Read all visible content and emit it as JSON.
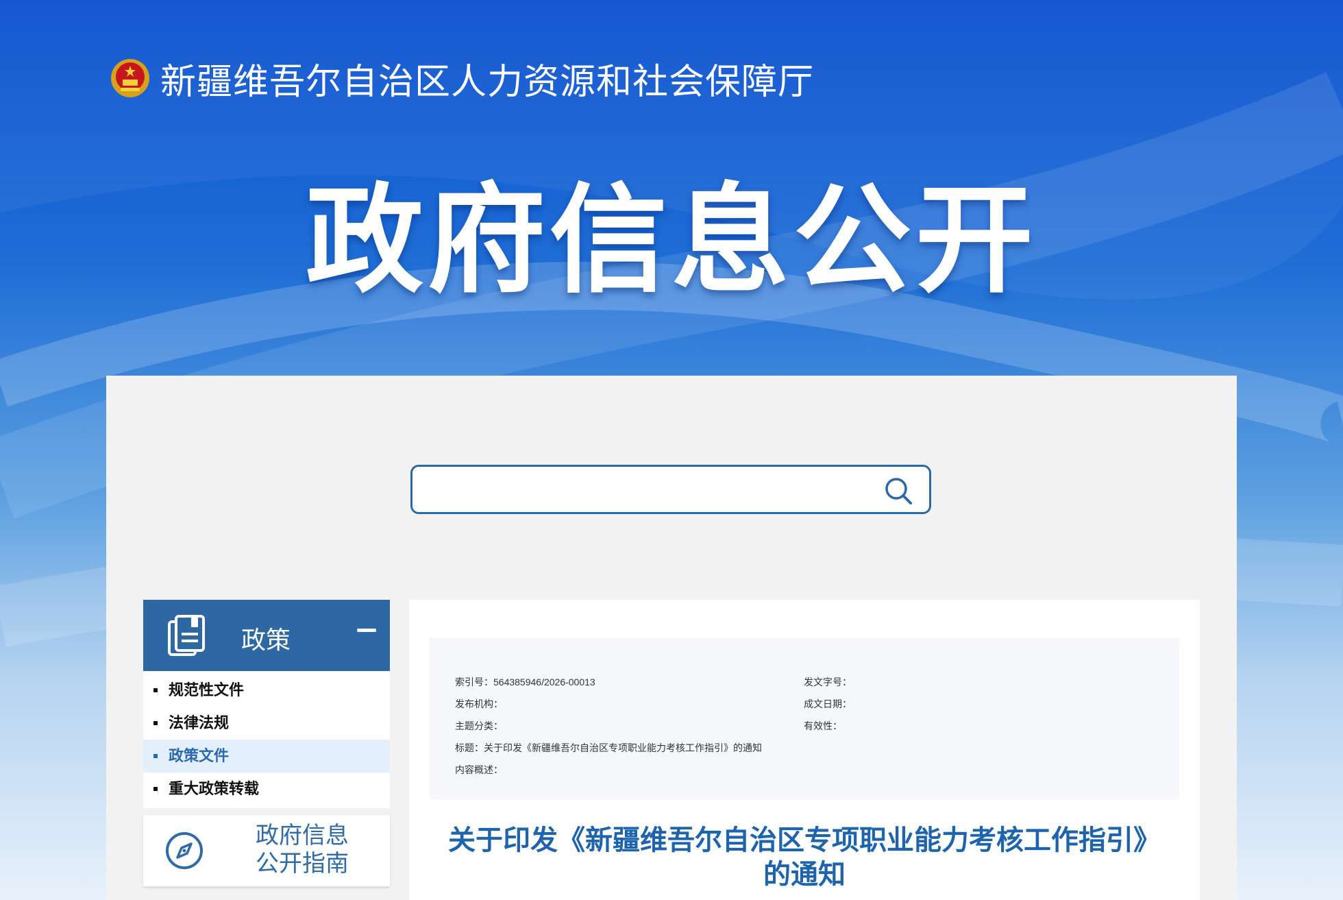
{
  "header": {
    "site_name": "新疆维吾尔自治区人力资源和社会保障厅",
    "hero_title": "政府信息公开"
  },
  "search": {
    "placeholder": "",
    "value": ""
  },
  "sidebar": {
    "section_title": "政策",
    "items": [
      {
        "label": "规范性文件",
        "active": false
      },
      {
        "label": "法律法规",
        "active": false
      },
      {
        "label": "政策文件",
        "active": true
      },
      {
        "label": "重大政策转载",
        "active": false
      }
    ],
    "guide_label_line1": "政府信息",
    "guide_label_line2": "公开指南"
  },
  "meta": {
    "index_no": "索引号：564385946/2026-00013",
    "doc_no": "发文字号：",
    "publisher": "发布机构：",
    "date": "成文日期：",
    "category": "主题分类：",
    "validity": "有效性：",
    "title": "标题：关于印发《新疆维吾尔自治区专项职业能力考核工作指引》的通知",
    "summary": "内容概述："
  },
  "document": {
    "title_line1": "关于印发《新疆维吾尔自治区专项职业能力考核工作指引》",
    "title_line2": "的通知"
  },
  "colors": {
    "primary": "#2d67a4",
    "title_blue": "#1e64ad",
    "active_bg": "#e3f0fb",
    "panel_bg": "#f2f2f2"
  },
  "icons": {
    "emblem": "national-emblem-icon",
    "search": "search-icon",
    "document": "document-stack-icon",
    "collapse": "minus-icon",
    "guide": "compass-icon"
  }
}
